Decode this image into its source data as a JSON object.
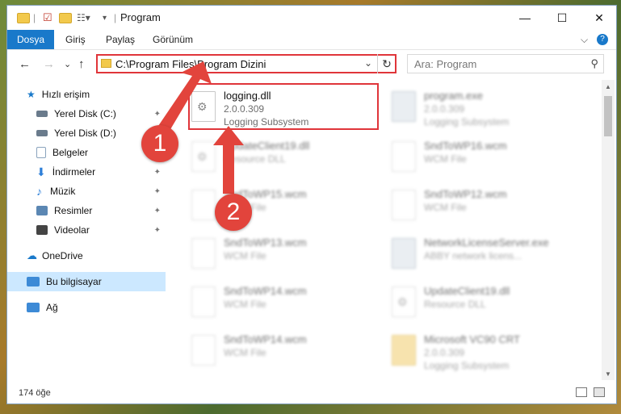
{
  "window": {
    "title": "Program",
    "controls": {
      "minimize": "—",
      "maximize": "☐",
      "close": "✕"
    }
  },
  "ribbon": {
    "file_tab": "Dosya",
    "tabs": [
      "Giriş",
      "Paylaş",
      "Görünüm"
    ],
    "help": "?",
    "collapse": "⌵"
  },
  "nav": {
    "back": "←",
    "forward": "→",
    "recent": "⌄",
    "up": "↑",
    "address": "C:\\Program Files\\Program Dizini",
    "address_dropdown": "⌄",
    "refresh": "↻",
    "search_placeholder": "Ara: Program",
    "search_icon": "⚲"
  },
  "sidebar": {
    "items": [
      {
        "label": "Hızlı erişim",
        "icon": "star-icon",
        "color": "#1979ca",
        "pinned": false
      },
      {
        "label": "Yerel Disk (C:)",
        "icon": "drive-icon",
        "color": "#6a7b8c",
        "pinned": true
      },
      {
        "label": "Yerel Disk (D:)",
        "icon": "drive-icon",
        "color": "#6a7b8c",
        "pinned": true
      },
      {
        "label": "Belgeler",
        "icon": "documents-icon",
        "color": "#8aa3bd",
        "pinned": true
      },
      {
        "label": "İndirmeler",
        "icon": "download-icon",
        "color": "#2d7fd8",
        "pinned": true
      },
      {
        "label": "Müzik",
        "icon": "music-icon",
        "color": "#2d7fd8",
        "pinned": true
      },
      {
        "label": "Resimler",
        "icon": "pictures-icon",
        "color": "#5b87b3",
        "pinned": true
      },
      {
        "label": "Videolar",
        "icon": "videos-icon",
        "color": "#444444",
        "pinned": true
      },
      {
        "label": "OneDrive",
        "icon": "cloud-icon",
        "color": "#1979ca",
        "pinned": false
      },
      {
        "label": "Bu bilgisayar",
        "icon": "computer-icon",
        "color": "#3d8ad6",
        "pinned": false,
        "selected": true
      },
      {
        "label": "Ağ",
        "icon": "network-icon",
        "color": "#3d8ad6",
        "pinned": false
      }
    ],
    "pin_glyph": "📌"
  },
  "files": [
    {
      "name": "logging.dll",
      "line2": "2.0.0.309",
      "line3": "Logging Subsystem",
      "icon": "gear-file-icon",
      "highlighted": true
    },
    {
      "name": "program.exe",
      "line2": "2.0.0.309",
      "line3": "Logging Subsystem",
      "icon": "exe-icon"
    },
    {
      "name": "UpdateClient19.dll",
      "line2": "Resource DLL",
      "line3": "",
      "icon": "gear-file-icon"
    },
    {
      "name": "SndToWP16.wcm",
      "line2": "WCM File",
      "line3": "",
      "icon": "blank-file-icon"
    },
    {
      "name": "SndToWP15.wcm",
      "line2": "WCM File",
      "line3": "",
      "icon": "blank-file-icon"
    },
    {
      "name": "SndToWP12.wcm",
      "line2": "WCM File",
      "line3": "",
      "icon": "blank-file-icon"
    },
    {
      "name": "SndToWP13.wcm",
      "line2": "WCM File",
      "line3": "",
      "icon": "blank-file-icon"
    },
    {
      "name": "NetworkLicenseServer.exe",
      "line2": "ABBY network licens...",
      "line3": "",
      "icon": "exe-icon"
    },
    {
      "name": "SndToWP14.wcm",
      "line2": "WCM File",
      "line3": "",
      "icon": "blank-file-icon"
    },
    {
      "name": "UpdateClient19.dll",
      "line2": "Resource DLL",
      "line3": "",
      "icon": "gear-file-icon"
    },
    {
      "name": "SndToWP14.wcm",
      "line2": "WCM File",
      "line3": "",
      "icon": "blank-file-icon"
    },
    {
      "name": "Microsoft VC90 CRT",
      "line2": "2.0.0.309",
      "line3": "Logging Subsystem",
      "icon": "folder-icon"
    }
  ],
  "status": {
    "item_count": "174 öğe"
  },
  "callouts": {
    "one": "1",
    "two": "2",
    "color": "#e2443c"
  }
}
